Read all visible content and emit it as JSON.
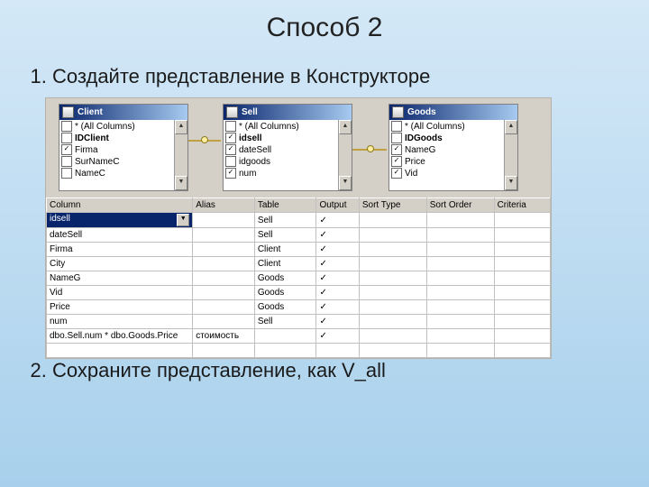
{
  "title": "Способ 2",
  "steps": {
    "s1": "Создайте представление в Конструкторе",
    "s2": "Сохраните представление, как V_all"
  },
  "tables": {
    "client": {
      "title": "Client",
      "cols": [
        {
          "chk": false,
          "label": "* (All Columns)"
        },
        {
          "chk": false,
          "label": "IDClient",
          "bold": true
        },
        {
          "chk": true,
          "label": "Firma"
        },
        {
          "chk": false,
          "label": "SurNameC"
        },
        {
          "chk": false,
          "label": "NameC"
        }
      ]
    },
    "sell": {
      "title": "Sell",
      "cols": [
        {
          "chk": false,
          "label": "* (All Columns)"
        },
        {
          "chk": true,
          "label": "idsell",
          "bold": true
        },
        {
          "chk": true,
          "label": "dateSell"
        },
        {
          "chk": false,
          "label": "idgoods"
        },
        {
          "chk": true,
          "label": "num"
        }
      ]
    },
    "goods": {
      "title": "Goods",
      "cols": [
        {
          "chk": false,
          "label": "* (All Columns)"
        },
        {
          "chk": false,
          "label": "IDGoods",
          "bold": true
        },
        {
          "chk": true,
          "label": "NameG"
        },
        {
          "chk": true,
          "label": "Price"
        },
        {
          "chk": true,
          "label": "Vid"
        }
      ]
    }
  },
  "grid": {
    "headers": {
      "column": "Column",
      "alias": "Alias",
      "table": "Table",
      "output": "Output",
      "sort_type": "Sort Type",
      "sort_order": "Sort Order",
      "criteria": "Criteria"
    },
    "rows": [
      {
        "column": "idsell",
        "alias": "",
        "table": "Sell",
        "output": "✓",
        "selected": true
      },
      {
        "column": "dateSell",
        "alias": "",
        "table": "Sell",
        "output": "✓"
      },
      {
        "column": "Firma",
        "alias": "",
        "table": "Client",
        "output": "✓"
      },
      {
        "column": "City",
        "alias": "",
        "table": "Client",
        "output": "✓"
      },
      {
        "column": "NameG",
        "alias": "",
        "table": "Goods",
        "output": "✓"
      },
      {
        "column": "Vid",
        "alias": "",
        "table": "Goods",
        "output": "✓"
      },
      {
        "column": "Price",
        "alias": "",
        "table": "Goods",
        "output": "✓"
      },
      {
        "column": "num",
        "alias": "",
        "table": "Sell",
        "output": "✓"
      },
      {
        "column": "dbo.Sell.num * dbo.Goods.Price",
        "alias": "стоимость",
        "table": "",
        "output": "✓"
      },
      {
        "column": "",
        "alias": "",
        "table": "",
        "output": ""
      }
    ]
  },
  "glyphs": {
    "up": "▲",
    "down": "▼"
  }
}
